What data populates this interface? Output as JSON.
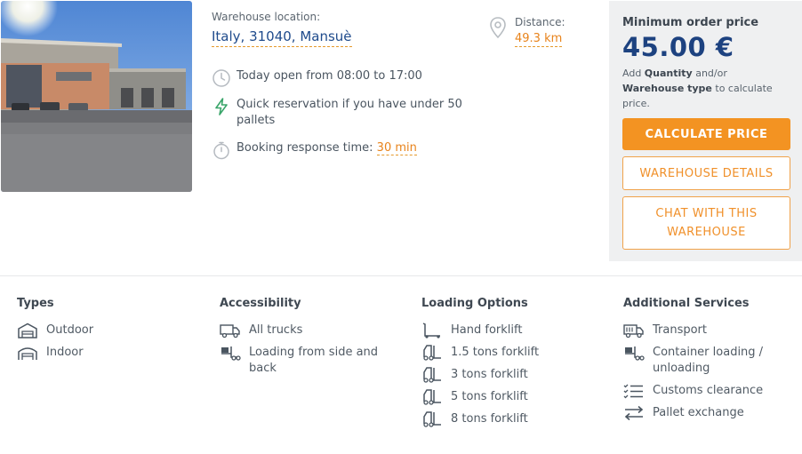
{
  "warehouse": {
    "location_label": "Warehouse location:",
    "location_value": "Italy, 31040, Mansuè",
    "distance_label": "Distance:",
    "distance_value": "49.3 km",
    "hours": "Today open from 08:00 to 17:00",
    "quick_reservation": "Quick reservation if you have under 50 pallets",
    "response_label": "Booking response time:",
    "response_value": "30 min"
  },
  "price": {
    "title": "Minimum order price",
    "value": "45.00 €",
    "hint_prefix": "Add",
    "hint_quantity": "Quantity",
    "hint_mid": "and/or",
    "hint_type": "Warehouse type",
    "hint_suffix": "to calculate price.",
    "calculate_label": "CALCULATE PRICE",
    "details_label": "WAREHOUSE DETAILS",
    "chat_label": "CHAT WITH THIS WAREHOUSE"
  },
  "colors": {
    "accent_orange": "#f39322",
    "primary_blue": "#1d4280",
    "quick_green": "#3aa56a"
  },
  "sections": {
    "types": {
      "title": "Types",
      "items": [
        {
          "label": "Outdoor",
          "icon": "outdoor-warehouse-icon"
        },
        {
          "label": "Indoor",
          "icon": "indoor-warehouse-icon"
        }
      ]
    },
    "accessibility": {
      "title": "Accessibility",
      "items": [
        {
          "label": "All trucks",
          "icon": "truck-icon"
        },
        {
          "label": "Loading from side and back",
          "icon": "loading-forklift-icon"
        }
      ]
    },
    "loading": {
      "title": "Loading Options",
      "items": [
        {
          "label": "Hand forklift",
          "icon": "hand-forklift-icon"
        },
        {
          "label": "1.5 tons forklift",
          "icon": "forklift-icon"
        },
        {
          "label": "3 tons forklift",
          "icon": "forklift-icon"
        },
        {
          "label": "5 tons forklift",
          "icon": "forklift-icon"
        },
        {
          "label": "8 tons forklift",
          "icon": "forklift-icon"
        }
      ]
    },
    "services": {
      "title": "Additional Services",
      "items": [
        {
          "label": "Transport",
          "icon": "truck-icon"
        },
        {
          "label": "Container loading / unloading",
          "icon": "loading-forklift-icon"
        },
        {
          "label": "Customs clearance",
          "icon": "checklist-icon"
        },
        {
          "label": "Pallet exchange",
          "icon": "exchange-arrows-icon"
        }
      ]
    }
  }
}
